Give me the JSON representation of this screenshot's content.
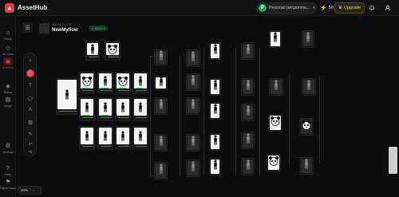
{
  "app": {
    "name": "AssetHub"
  },
  "topbar": {
    "workspace_initial": "P",
    "workspace_name": "Personal (aergamma...",
    "credits": "50",
    "upgrade_label": "Upgrade"
  },
  "nav": [
    {
      "label": "Home",
      "icon": "home-icon"
    },
    {
      "label": "3D Asset",
      "icon": "cube-icon"
    },
    {
      "label": "Workflow",
      "icon": "workflow-icon",
      "active": true
    },
    {
      "label": "Refine",
      "icon": "refine-icon"
    },
    {
      "label": "Image",
      "icon": "image-icon"
    },
    {
      "label": "Settings",
      "icon": "gear-icon"
    },
    {
      "label": "Help",
      "icon": "help-icon"
    },
    {
      "label": "Report Issue",
      "icon": "flag-icon"
    }
  ],
  "workflow": {
    "kicker": "WORKFLOW",
    "title": "NewMyflow",
    "status": "Synced"
  },
  "zoom": {
    "value": "20%"
  },
  "colors": {
    "accent": "#e23b4a",
    "success": "#38c172",
    "upgrade": "#f0d68a"
  }
}
